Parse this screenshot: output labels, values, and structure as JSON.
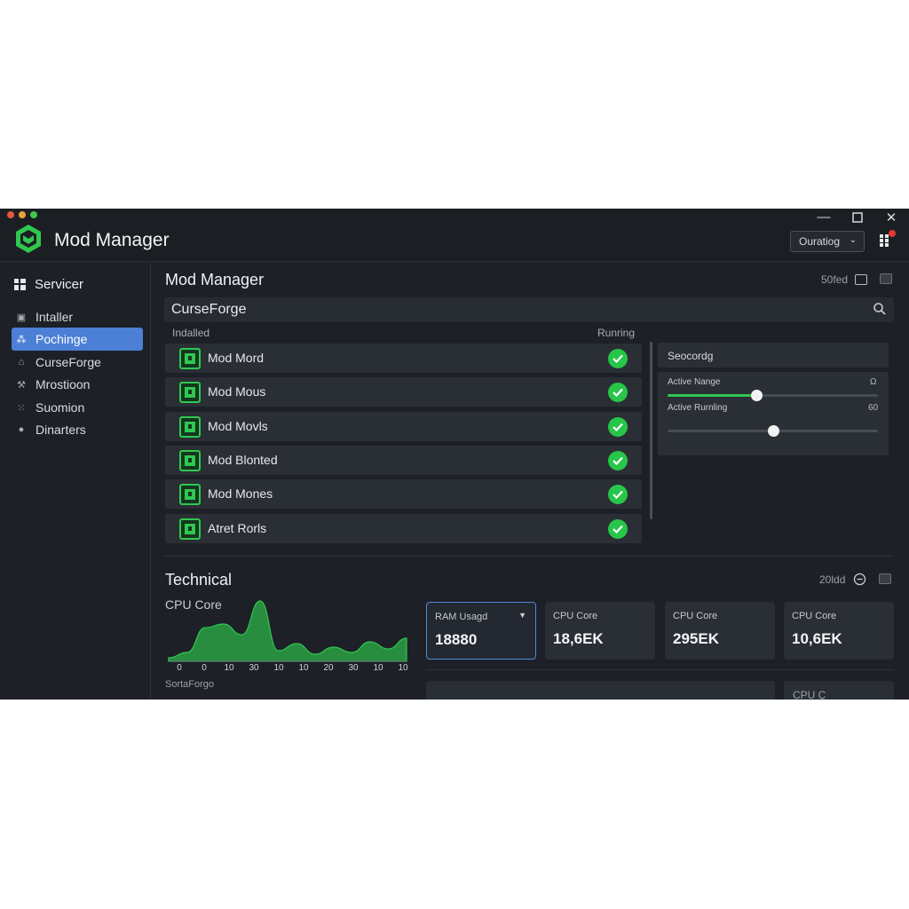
{
  "app": {
    "title": "Mod Manager"
  },
  "titlebar": {
    "dropdown_value": "Ouratiog",
    "notif_icon": "bell-dot"
  },
  "sidebar": {
    "header": {
      "label": "Servicer",
      "icon": "grid-icon"
    },
    "items": [
      {
        "label": "Intaller",
        "icon": "box-icon",
        "active": false
      },
      {
        "label": "Pochinge",
        "icon": "people-icon",
        "active": true
      },
      {
        "label": "CurseForge",
        "icon": "home-icon",
        "active": false
      },
      {
        "label": "Mrostioon",
        "icon": "wrench-icon",
        "active": false
      },
      {
        "label": "Suomion",
        "icon": "grid-dots-icon",
        "active": false
      },
      {
        "label": "Dinarters",
        "icon": "circle-icon",
        "active": false
      }
    ]
  },
  "main": {
    "title": "Mod Manager",
    "sort_label": "50fed",
    "search": {
      "value": "CurseForge"
    },
    "columns": {
      "installed": "Indalled",
      "running": "Runring"
    },
    "mods": [
      {
        "name": "Mod Mord",
        "status": "running"
      },
      {
        "name": "Mod Mous",
        "status": "running"
      },
      {
        "name": "Mod Movls",
        "status": "running"
      },
      {
        "name": "Mod Blonted",
        "status": "running"
      },
      {
        "name": "Mod Mones",
        "status": "running"
      },
      {
        "name": "Atret Rorls",
        "status": "running"
      }
    ]
  },
  "settings_panel": {
    "title": "Seocordg",
    "sliders": [
      {
        "label": "Active Nange",
        "value_text": "Ω",
        "level": 0.42
      },
      {
        "label": "Active Rurnling",
        "value_text": "60",
        "level": 0.5
      }
    ]
  },
  "technical": {
    "title": "Technical",
    "meta": "20ldd",
    "chart_label": "CPU Core",
    "sub_label": "SortaForgo",
    "stats": [
      {
        "label": "RAM Usagd",
        "value": "18880",
        "selected": true
      },
      {
        "label": "CPU Core",
        "value": "18,6EK",
        "selected": false
      },
      {
        "label": "CPU Core",
        "value": "295EK",
        "selected": false
      },
      {
        "label": "CPU Core",
        "value": "10,6EK",
        "selected": false
      }
    ],
    "bottom_card_label": "CPU Ç"
  },
  "chart_data": {
    "type": "area",
    "x": [
      "0",
      "0",
      "10",
      "30",
      "10",
      "10",
      "20",
      "30",
      "10",
      "10"
    ],
    "values": [
      4,
      10,
      38,
      42,
      30,
      68,
      12,
      20,
      8,
      16,
      10,
      22,
      14,
      26
    ],
    "color": "#2fc84f",
    "grid": false
  },
  "colors": {
    "accent": "#4c7fd6",
    "success": "#27c64a",
    "background": "#1d2026"
  }
}
